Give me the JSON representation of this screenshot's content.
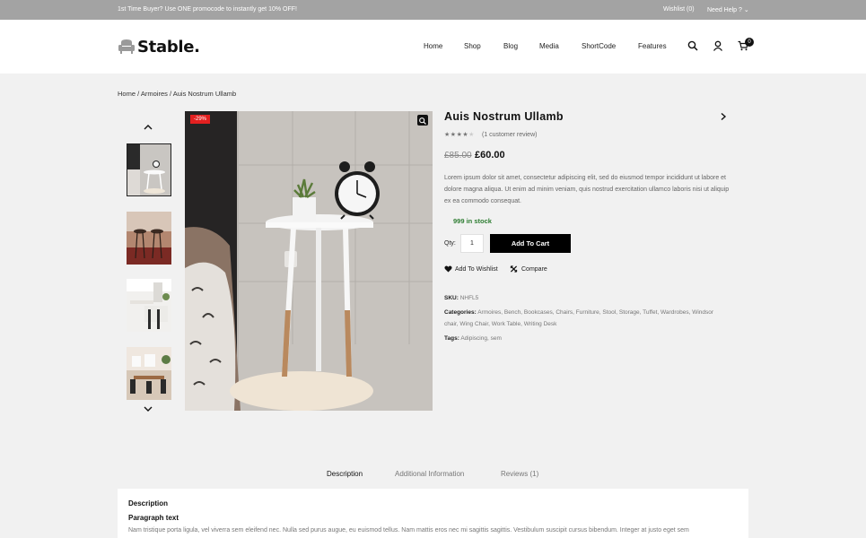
{
  "topbar": {
    "promo": "1st Time Buyer? Use ONE promocode to instantly get 10% OFF!",
    "wishlist": "Wishlist (0)",
    "help": "Need Help ?"
  },
  "header": {
    "logo_text": "Stable.",
    "nav": [
      "Home",
      "Shop",
      "Blog",
      "Media",
      "ShortCode",
      "Features"
    ],
    "cart_count": "0"
  },
  "breadcrumb": {
    "items": [
      "Home",
      "Armoires",
      "Auis Nostrum Ullamb"
    ],
    "separator": "/"
  },
  "gallery": {
    "sale_badge": "-29%",
    "thumbs": [
      "nightstand",
      "bar-stools",
      "kitchen",
      "dining-room"
    ],
    "active_thumb": "nightstand"
  },
  "product": {
    "title": "Auis Nostrum Ullamb",
    "rating": 4,
    "rating_max": 5,
    "review_count": "(1 customer review)",
    "old_price": "£85.00",
    "new_price": "£60.00",
    "description": "Lorem ipsum dolor sit amet, consectetur adipiscing elit, sed do eiusmod tempor incididunt ut labore et dolore magna aliqua. Ut enim ad minim veniam, quis nostrud exercitation ullamco laboris nisi ut aliquip ex ea commodo consequat.",
    "stock": "999 in stock",
    "qty_label": "Qty:",
    "qty_value": "1",
    "add_to_cart": "Add To Cart",
    "add_to_wishlist": "Add To Wishlist",
    "compare": "Compare",
    "sku_label": "SKU:",
    "sku_value": "NHFL5",
    "categories_label": "Categories:",
    "categories": [
      "Armoires",
      "Bench",
      "Bookcases",
      "Chairs",
      "Furniture",
      "Stool",
      "Storage",
      "Tuffet",
      "Wardrobes",
      "Windsor chair",
      "Wing Chair",
      "Work Table",
      "Writing Desk"
    ],
    "tags_label": "Tags:",
    "tags": [
      "Adipiscing",
      "sem"
    ]
  },
  "tabs": [
    "Description",
    "Additional Information",
    "Reviews (1)"
  ],
  "active_tab": "Description",
  "panel": {
    "heading": "Description",
    "subheading": "Paragraph text",
    "text": "Nam tristique porta ligula, vel viverra sem eleifend nec. Nulla sed purus augue, eu euismod tellus. Nam mattis eros nec mi sagittis sagittis. Vestibulum suscipit cursus bibendum. Integer at justo eget sem"
  },
  "colors": {
    "topbar": "#a3a3a3",
    "accent": "#000000",
    "sale": "#e32020",
    "stock": "#2e7d32",
    "page_bg": "#f1f1f1"
  }
}
